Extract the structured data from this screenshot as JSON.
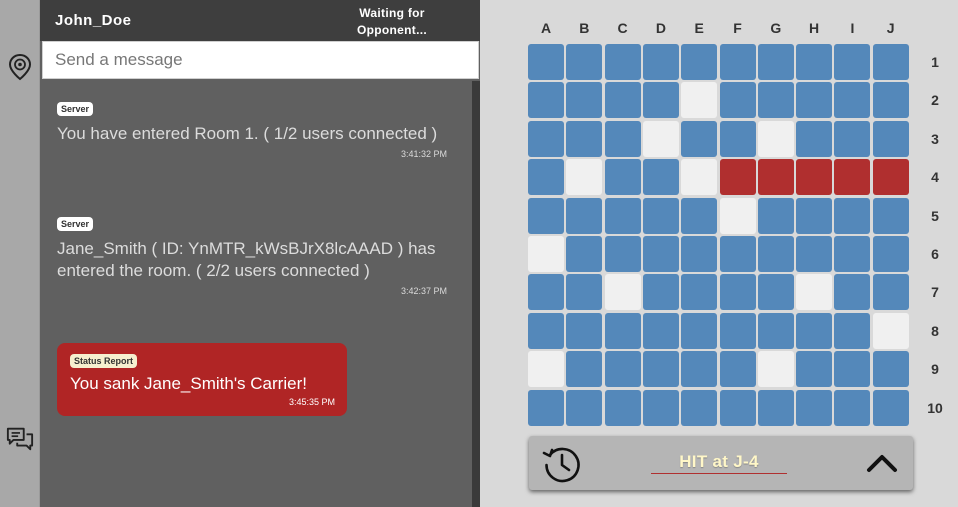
{
  "header": {
    "username": "John_Doe",
    "status": "Waiting for Opponent..."
  },
  "chat": {
    "input_placeholder": "Send a message",
    "messages": [
      {
        "sender": "Server",
        "text": "You have entered Room 1. ( 1/2 users connected )",
        "time": "3:41:32 PM"
      },
      {
        "sender": "Server",
        "text": "Jane_Smith ( ID: YnMTR_kWsBJrX8lcAAAD ) has entered the room. ( 2/2 users connected )",
        "time": "3:42:37 PM"
      }
    ],
    "status_report": {
      "tag": "Status Report",
      "text": "You sank Jane_Smith's Carrier!",
      "time": "3:45:35 PM"
    }
  },
  "rail": {
    "icons": [
      "location-pin-icon",
      "chat-bubbles-icon"
    ]
  },
  "board": {
    "columns": [
      "A",
      "B",
      "C",
      "D",
      "E",
      "F",
      "G",
      "H",
      "I",
      "J"
    ],
    "rows": [
      "1",
      "2",
      "3",
      "4",
      "5",
      "6",
      "7",
      "8",
      "9",
      "10"
    ],
    "cell_states_legend": {
      "w": "water",
      "m": "miss",
      "h": "hit"
    },
    "cells": [
      "wwwwwwwwww",
      "wwwwmwwwww",
      "wwwmwwmwww",
      "wmwwmhhhhh",
      "wwwwwmwwww",
      "mwwwwwwwww",
      "wwmwwwwmww",
      "wwwwwwwwwm",
      "mwwwwwmwww",
      "wwwwwwwwww"
    ],
    "colors": {
      "water": "#5488ba",
      "miss": "#f0f0f0",
      "hit": "#b02f2f"
    }
  },
  "log": {
    "last_move": "HIT at J-4",
    "icons": [
      "history-icon",
      "chevron-up-icon"
    ]
  }
}
